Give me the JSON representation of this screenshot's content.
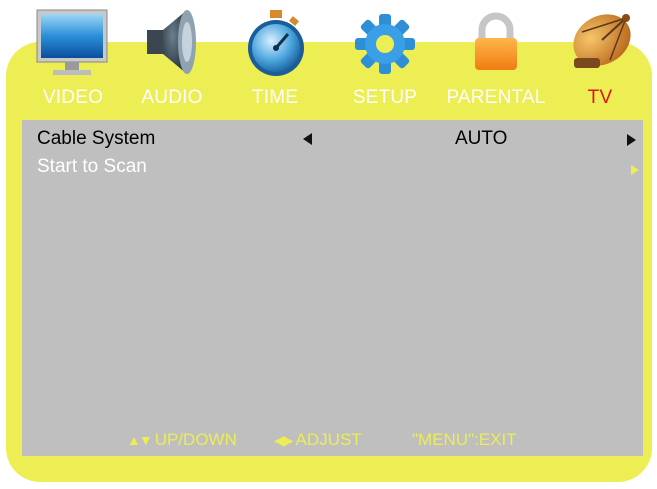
{
  "tabs": [
    {
      "label": "VIDEO",
      "icon": "monitor-icon",
      "active": false
    },
    {
      "label": "AUDIO",
      "icon": "speaker-icon",
      "active": false
    },
    {
      "label": "TIME",
      "icon": "stopwatch-icon",
      "active": false
    },
    {
      "label": "SETUP",
      "icon": "gear-icon",
      "active": false
    },
    {
      "label": "PARENTAL",
      "icon": "lock-icon",
      "active": false
    },
    {
      "label": "TV",
      "icon": "satellite-dish-icon",
      "active": true
    }
  ],
  "settings": [
    {
      "label": "Cable System",
      "value": "AUTO",
      "selected": true
    },
    {
      "label": "Start to Scan",
      "value": "",
      "selected": false
    }
  ],
  "hints": {
    "up_down": "UP/DOWN",
    "adjust": "ADJUST",
    "exit": "\"MENU\":EXIT",
    "up_down_glyph": "▲▼",
    "adjust_glyph": "◀▶"
  },
  "colors": {
    "frame": "#eded54",
    "panel": "#bfbfbf",
    "active_tab": "#e2121b"
  }
}
